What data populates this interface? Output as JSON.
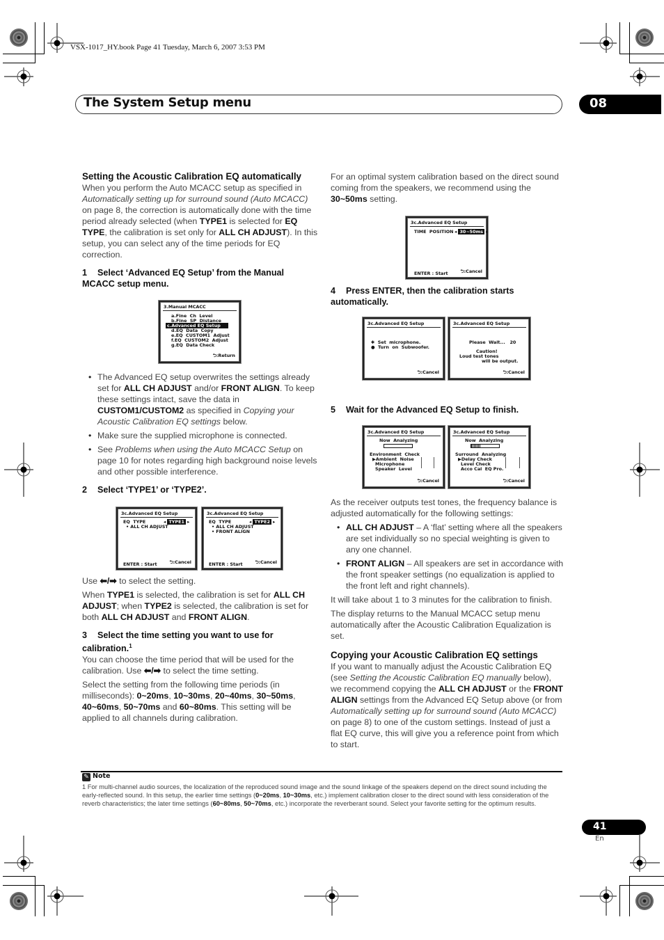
{
  "slug": "VSX-1017_HY.book  Page 41  Tuesday, March 6, 2007  3:53 PM",
  "header": {
    "title": "The System Setup menu",
    "chapter": "08"
  },
  "left": {
    "section_title": "Setting the Acoustic Calibration EQ automatically",
    "intro": {
      "p1": "When you perform the Auto MCACC setup as specified in ",
      "i1": "Automatically setting up for surround sound (Auto MCACC)",
      "p2": " on page 8, the correction is automatically done with the time period already selected (when ",
      "b1": "TYPE1",
      "p3": " is selected for ",
      "b2": "EQ TYPE",
      "p4": ", the calibration is set only for ",
      "b3": "ALL CH ADJUST",
      "p5": "). In this setup, you can select any of the time periods for EQ correction."
    },
    "step1": {
      "num": "1",
      "text": "Select ‘Advanced EQ Setup’ from the Manual MCACC setup menu."
    },
    "bullets": {
      "b1": {
        "t1": "The Advanced EQ setup overwrites the settings already set for ",
        "k1": "ALL CH ADJUST",
        "t2": " and/or ",
        "k2": "FRONT ALIGN",
        "t3": ". To keep these settings intact, save the data in ",
        "k3": "CUSTOM1",
        "t4": "/",
        "k4": "CUSTOM2",
        "t5": " as specified in ",
        "i1": "Copying your Acoustic Calibration EQ settings",
        "t6": " below."
      },
      "b2": "Make sure the supplied microphone is connected.",
      "b3": {
        "t1": "See ",
        "i1": "Problems when using the Auto MCACC Setup",
        "t2": " on page 10 for notes regarding high background noise levels and other possible interference."
      }
    },
    "step2": {
      "num": "2",
      "text": "Select ‘TYPE1’ or ‘TYPE2’."
    },
    "use_line": {
      "t1": "Use ",
      "arrows": "⬅/➡",
      "t2": " to select the setting."
    },
    "type_para": {
      "t1": "When ",
      "k1": "TYPE1",
      "t2": " is selected, the calibration is set for ",
      "k2": "ALL CH ADJUST",
      "t3": "; when ",
      "k3": "TYPE2",
      "t4": " is selected, the calibration is set for both ",
      "k4": "ALL CH ADJUST",
      "t5": " and ",
      "k5": "FRONT ALIGN",
      "t6": "."
    },
    "step3": {
      "num": "3",
      "text": "Select the time setting you want to use for calibration.",
      "sup": "1"
    },
    "step3_p1": {
      "t1": "You can choose the time period that will be used for the calibration. Use ",
      "arrows": "⬅/➡",
      "t2": " to select the time setting."
    },
    "step3_p2": {
      "t1": "Select the setting from the following time periods (in milliseconds): ",
      "v1": "0~20ms",
      "v2": "10~30ms",
      "v3": "20~40ms",
      "v4": "30~50ms",
      "v5": "40~60ms",
      "v6": "50~70ms",
      "and": " and ",
      "v7": "60~80ms",
      "t2": ". This setting will be applied to all channels during calibration.",
      "sep": ", "
    }
  },
  "right": {
    "recommend": {
      "t1": "For an optimal system calibration based on the direct sound coming from the speakers, we recommend using the ",
      "k1": "30~50ms",
      "t2": " setting."
    },
    "step4": {
      "num": "4",
      "text": "Press ENTER, then the calibration starts automatically."
    },
    "step5": {
      "num": "5",
      "text": "Wait for the Advanced EQ Setup to finish."
    },
    "tones": "As the receiver outputs test tones, the frequency balance is adjusted automatically for the following settings:",
    "bullets": {
      "b1": {
        "k": "ALL CH ADJUST",
        "t": " – A ‘flat’ setting where all the speakers are set individually so no special weighting is given to any one channel."
      },
      "b2": {
        "k": "FRONT ALIGN",
        "t": " – All speakers are set in accordance with the front speaker settings (no equalization is applied to the front left and right channels)."
      }
    },
    "duration": "It will take about 1 to 3 minutes for the calibration to finish.",
    "returns": "The display returns to the Manual MCACC setup menu automatically after the Acoustic Calibration Equalization is set.",
    "copy_title": "Copying your Acoustic Calibration EQ settings",
    "copy": {
      "t1": "If you want to manually adjust the Acoustic Calibration EQ (see ",
      "i1": "Setting the Acoustic Calibration EQ manually",
      "t2": " below), we recommend copying the ",
      "k1": "ALL CH ADJUST",
      "t3": " or the ",
      "k2": "FRONT ALIGN",
      "t4": " settings from the Advanced EQ Setup above (or from ",
      "i2": "Automatically setting up for surround sound (Auto MCACC)",
      "t5": " on page 8) to one of the custom settings. Instead of just a flat EQ curve, this will give you a reference point from which to start."
    }
  },
  "screens": {
    "manual_mcacc": {
      "title": "3.Manual  MCACC",
      "items": [
        "a.Fine  Ch  Level",
        "b.Fine  SP  Distance",
        "c.Advanced EQ Setup",
        "d.EQ  Data  Copy",
        "e.EQ  CUSTOM1  Adjust",
        "f.EQ  CUSTOM2  Adjust",
        "g.EQ  Data Check"
      ],
      "selected_index": 2,
      "footer": "⮌:Return"
    },
    "type1": {
      "title": "3c.Advanced EQ Setup",
      "label": "EQ  TYPE",
      "value": "TYPE1",
      "lines": [
        "• ALL CH ADJUST"
      ],
      "footer_left": "ENTER : Start",
      "footer_right": "⮌:Cancel"
    },
    "type2": {
      "title": "3c.Advanced EQ Setup",
      "label": "EQ  TYPE",
      "value": "TYPE2",
      "lines": [
        "• ALL CH ADJUST",
        "• FRONT ALIGN"
      ],
      "footer_left": "ENTER : Start",
      "footer_right": "⮌:Cancel"
    },
    "time": {
      "title": "3c.Advanced EQ Setup",
      "label": "TIME  POSITION",
      "value": "30~50ms",
      "footer_left": "ENTER : Start",
      "footer_right": "⮌:Cancel"
    },
    "mic": {
      "title": "3c.Advanced EQ Setup",
      "lines": [
        "✱  Set  microphone.",
        "●  Turn  on  Subwoofer."
      ],
      "footer_right": "⮌:Cancel"
    },
    "wait": {
      "title": "3c.Advanced EQ Setup",
      "wait": "Please  Wait...   20",
      "caution": "Caution!",
      "l1": "Loud test tones",
      "l2": "will be output.",
      "footer_right": "⮌:Cancel"
    },
    "analyze1": {
      "title": "3c.Advanced EQ Setup",
      "status": "Now  Analyzing",
      "progress": 0.0,
      "group": "Environment  Check",
      "items": [
        "▶Ambient  Noise",
        "Microphone",
        "Speaker  Level"
      ],
      "footer_right": "⮌:Cancel"
    },
    "analyze2": {
      "title": "3c.Advanced EQ Setup",
      "status": "Now  Analyzing",
      "progress": 0.35,
      "group": "Surround  Analyzing",
      "items": [
        "▶Delay Check",
        "Level Check",
        "Acco Cal  EQ Pro."
      ],
      "footer_right": "⮌:Cancel"
    }
  },
  "note": {
    "title": "Note",
    "t1": "1  For multi-channel audio sources, the localization of the reproduced sound image and the sound linkage of the speakers depend on the direct sound including the early-reflected sound. In this setup, the earlier time settings (",
    "k1": "0~20ms",
    "sep": ", ",
    "k2": "10~30ms",
    "t2": ", etc.) implement calibration closer to the direct sound with less consideration of the reverb characteristics; the later time settings (",
    "k3": "60~80ms",
    "k4": "50~70ms",
    "t3": ", etc.) incorporate the reverberant sound. Select your favorite setting for the optimum results."
  },
  "footer": {
    "page": "41",
    "lang": "En"
  }
}
